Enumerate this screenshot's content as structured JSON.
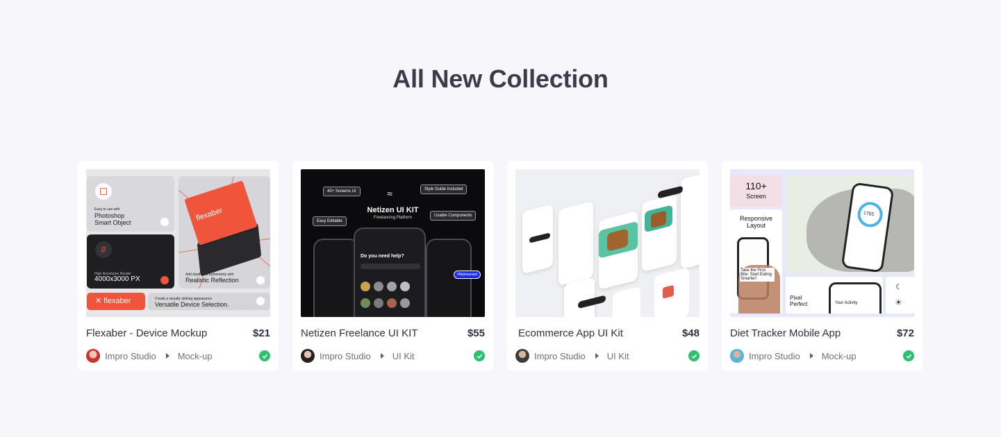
{
  "section": {
    "title": "All New Collection"
  },
  "cards": [
    {
      "title": "Flexaber - Device Mockup",
      "price": "$21",
      "author": "Impro Studio",
      "category": "Mock-up",
      "thumb": {
        "brand": "flexaber",
        "easy": "Easy to use with",
        "photoshop": "Photoshop",
        "smart": "Smart Object",
        "hires": "High Resolution Render",
        "px": "4000x3000 PX",
        "add": "Add depth and authenticity with",
        "reflect": "Realistic Reflection",
        "create": "Create a visually striking appearance",
        "versatile": "Versatile Device Selection."
      }
    },
    {
      "title": "Netizen Freelance UI KIT",
      "price": "$55",
      "author": "Impro Studio",
      "category": "UI Kit",
      "thumb": {
        "kit": "Netizen UI KIT",
        "sub": "Freelancing Platform",
        "screens": "40+ Screens UI",
        "style": "Style Guide Included",
        "easy": "Easy Editable",
        "usable": "Usable Components",
        "help": "Do you need help?",
        "tag": "#Mykreanaut"
      }
    },
    {
      "title": "Ecommerce App UI Kit",
      "price": "$48",
      "author": "Impro Studio",
      "category": "UI Kit"
    },
    {
      "title": "Diet Tracker Mobile App",
      "price": "$72",
      "author": "Impro Studio",
      "category": "Mock-up",
      "thumb": {
        "screens_num": "110+",
        "screens": "Screen",
        "responsive": "Responsive Layout",
        "take": "Take the First Bite: Start Eating Smarter!",
        "pixel": "Pixel Perfect",
        "activity": "Your Activity",
        "value": "1765"
      }
    }
  ],
  "colors": {
    "verified": "#2fbf71",
    "accent": "#f0553b"
  }
}
